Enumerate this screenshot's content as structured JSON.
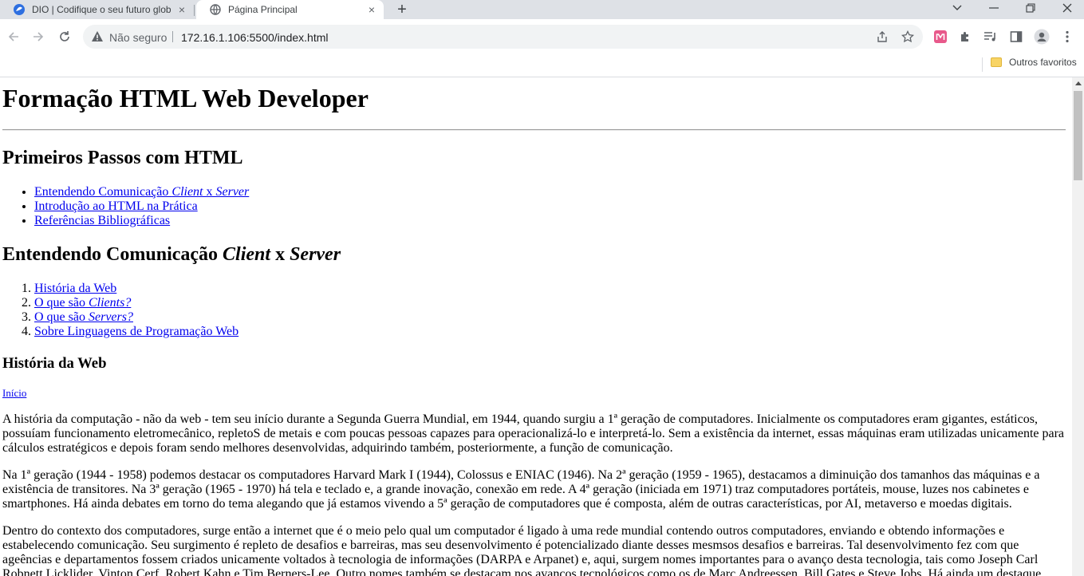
{
  "tabs": [
    {
      "title": "DIO | Codifique o seu futuro glob",
      "close": "×"
    },
    {
      "title": "Página Principal",
      "close": "×"
    }
  ],
  "new_tab": "+",
  "window_controls": {
    "chevron": "⌄",
    "minimize": "—",
    "restore": "❐",
    "close": "✕"
  },
  "address_bar": {
    "security_label": "Não seguro",
    "url": "172.16.1.106:5500/index.html"
  },
  "bookmarks_bar": {
    "other_favorites": "Outros favoritos"
  },
  "page": {
    "h1": "Formação HTML Web Developer",
    "section1": {
      "title": "Primeiros Passos com HTML",
      "items": [
        {
          "pre": "Entendendo Comunicação ",
          "em1": "Client",
          "mid": " x ",
          "em2": "Server"
        },
        {
          "text": "Introdução ao HTML na Prática"
        },
        {
          "text": "Referências Bibliográficas"
        }
      ]
    },
    "section2": {
      "title_pre": "Entendendo Comunicação ",
      "title_em1": "Client",
      "title_mid": " x ",
      "title_em2": "Server",
      "items": [
        {
          "num": "1.",
          "pre": "História da Web",
          "em": ""
        },
        {
          "num": "2.",
          "pre": "O que são ",
          "em": "Clients?"
        },
        {
          "num": "3.",
          "pre": "O que são ",
          "em": "Servers?"
        },
        {
          "num": "4.",
          "pre": "Sobre Linguagens de Programação Web",
          "em": ""
        }
      ]
    },
    "section3": {
      "title": "História da Web",
      "back_link": "Início",
      "paragraphs": [
        "A história da computação - não da web - tem seu início durante a Segunda Guerra Mundial, em 1944, quando surgiu a 1ª geração de computadores. Inicialmente os computadores eram gigantes, estáticos, possuíam funcionamento eletromecânico, repletoS de metais e com poucas pessoas capazes para operacionalizá-lo e interpretá-lo. Sem a existência da internet, essas máquinas eram utilizadas unicamente para cálculos estratégicos e depois foram sendo melhores desenvolvidas, adquirindo também, posteriormente, a função de comunicação.",
        "Na 1ª geração (1944 - 1958) podemos destacar os computadores Harvard Mark I (1944), Colossus e ENIAC (1946). Na 2ª geração (1959 - 1965), destacamos a diminuição dos tamanhos das máquinas e a existência de transitores. Na 3ª geração (1965 - 1970) há tela e teclado e, a grande inovação, conexão em rede. A 4ª geração (iniciada em 1971) traz computadores portáteis, mouse, luzes nos cabinetes e smartphones. Há ainda debates em torno do tema alegando que já estamos vivendo a 5ª geração de computadores que é composta, além de outras características, por AI, metaverso e moedas digitais.",
        "Dentro do contexto dos computadores, surge então a internet que é o meio pelo qual um computador é ligado à uma rede mundial contendo outros computadores, enviando e obtendo informações e estabelecendo comunicação. Seu surgimento é repleto de desafios e barreiras, mas seu desenvolvimento é potencializado diante desses mesmsos desafios e barreiras. Tal desenvolvimento fez com que ageências e departamentos fossem criados unicamente voltados à tecnologia de informações (DARPA e Arpanet) e, aqui, surgem nomes importantes para o avanço desta tecnologia, tais como Joseph Carl Robnett Licklider, Vinton Cerf, Robert Kahn e Tim Berners-Lee. Outro nomes também se destacam nos avanços tecnológicos como os de Marc Andreessen, Bill Gates e Steve Jobs. Há ainda um destaque"
      ]
    }
  },
  "colors": {
    "link": "#0000ee",
    "tabbar": "#dee1e6",
    "omnibox": "#f1f3f4",
    "profile_ext": "#e8598b"
  }
}
